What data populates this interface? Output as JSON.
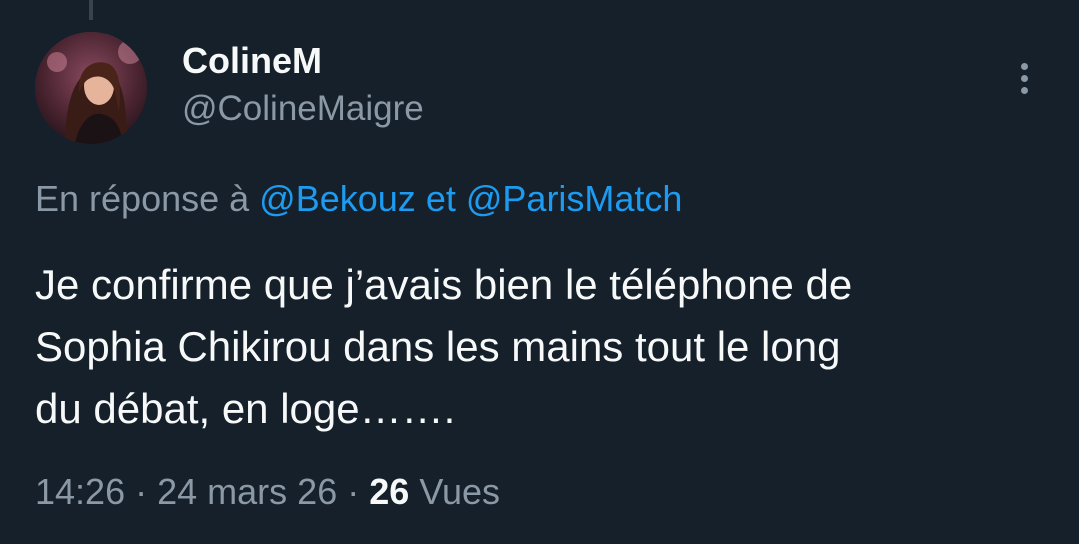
{
  "tweet": {
    "author": {
      "display_name": "ColineM",
      "handle": "@ColineMaigre",
      "avatar_icon": "profile-photo"
    },
    "reply_context": {
      "prefix": "En réponse à",
      "mention_1": "@Bekouz",
      "conjunction": "et",
      "mention_2": "@ParisMatch"
    },
    "text_lines": [
      "Je confirme que j’avais bien le téléphone de",
      "Sophia Chikirou dans les mains tout le long",
      "du débat, en loge……."
    ],
    "meta": {
      "time": "14:26",
      "separator_1": "·",
      "date": "24 mars 26",
      "separator_2": "·",
      "views_count": "26",
      "views_label": "Vues"
    },
    "more_icon": "more-vertical-icon"
  },
  "colors": {
    "background": "#15202b",
    "primary_text": "#f7f9f9",
    "secondary_text": "#8b98a5",
    "accent": "#1d9bf0"
  }
}
